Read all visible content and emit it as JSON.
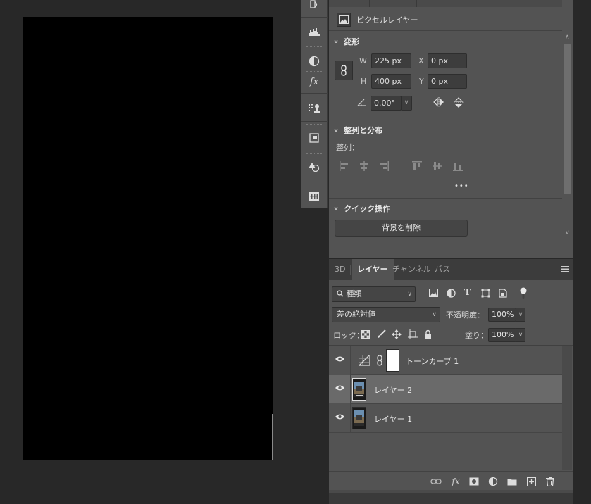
{
  "properties": {
    "layer_type_label": "ピクセルレイヤー",
    "transform": {
      "title": "変形",
      "w_label": "W",
      "w_value": "225 px",
      "h_label": "H",
      "h_value": "400 px",
      "x_label": "X",
      "x_value": "0 px",
      "y_label": "Y",
      "y_value": "0 px",
      "angle_value": "0.00°"
    },
    "align": {
      "title": "整列と分布",
      "sub_label": "整列：",
      "more": "•••"
    },
    "quick_actions": {
      "title": "クイック操作",
      "remove_bg_label": "背景を削除"
    }
  },
  "layers_panel": {
    "tabs": [
      {
        "label": "3D",
        "active": false
      },
      {
        "label": "レイヤー",
        "active": true
      },
      {
        "label": "チャンネル",
        "active": false
      },
      {
        "label": "パス",
        "active": false
      }
    ],
    "filter_kind": "種類",
    "blend_mode": "差の絶対値",
    "opacity_label": "不透明度：",
    "opacity_value": "100%",
    "lock_label": "ロック：",
    "fill_label": "塗り：",
    "fill_value": "100%",
    "layers": [
      {
        "name": "トーンカーブ 1",
        "type": "adjustment",
        "visible": true,
        "selected": false
      },
      {
        "name": "レイヤー 2",
        "type": "pixel",
        "visible": true,
        "selected": true
      },
      {
        "name": "レイヤー 1",
        "type": "pixel",
        "visible": true,
        "selected": false
      }
    ]
  },
  "colors": {
    "panel_bg": "#535353",
    "workspace_bg": "#282828",
    "selected_row": "#6a6a6a",
    "document_fill": "#000000"
  }
}
